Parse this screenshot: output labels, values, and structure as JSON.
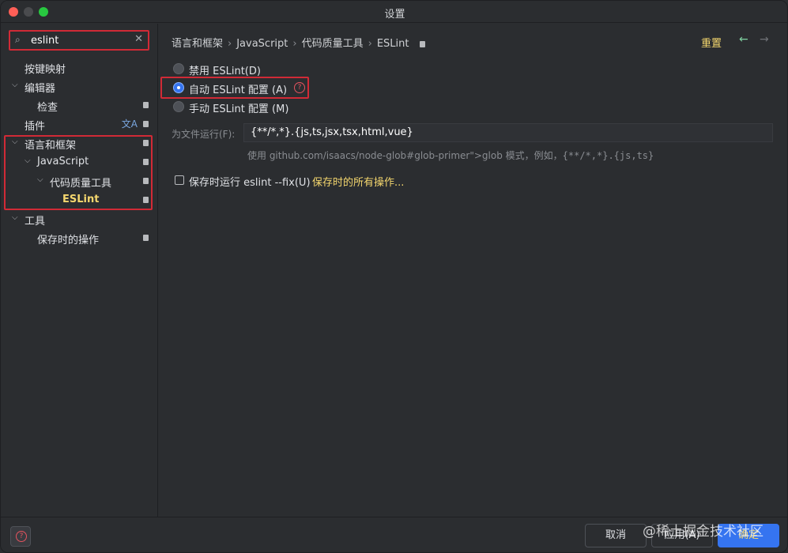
{
  "window": {
    "title": "设置"
  },
  "search": {
    "value": "eslint",
    "clear_icon": "close-icon"
  },
  "sidebar": {
    "items": [
      {
        "label": "按键映射"
      },
      {
        "label": "编辑器"
      },
      {
        "label": "检查"
      },
      {
        "label": "插件"
      },
      {
        "label": "语言和框架"
      },
      {
        "label": "JavaScript"
      },
      {
        "label": "代码质量工具"
      },
      {
        "label": "ESLint"
      },
      {
        "label": "工具"
      },
      {
        "label": "保存时的操作"
      }
    ]
  },
  "breadcrumb": {
    "items": [
      "语言和框架",
      "JavaScript",
      "代码质量工具",
      "ESLint"
    ]
  },
  "header": {
    "reset_label": "重置"
  },
  "eslint": {
    "option_disable": "禁用 ESLint(D)",
    "option_auto": "自动 ESLint 配置 (A)",
    "option_manual": "手动 ESLint 配置 (M)",
    "selected": "option_auto",
    "file_run_label": "为文件运行(F):",
    "file_run_value": "{**/*,*}.{js,ts,jsx,tsx,html,vue}",
    "hint_prefix": "使用 github.com/isaacs/node-glob#glob-primer\">glob 模式，例如，",
    "hint_example": "{**/*,*}.{js,ts}",
    "fix_on_save_label": "保存时运行 eslint --fix(U)",
    "fix_on_save_checked": false,
    "all_save_actions_link": "保存时的所有操作..."
  },
  "footer": {
    "cancel_label": "取消",
    "apply_label": "应用(A)",
    "ok_label": "确定"
  },
  "watermark": "@稀土掘金技术社区",
  "colors": {
    "accent": "#3574f0",
    "highlight": "#d12a36",
    "link": "#f5d76e"
  }
}
